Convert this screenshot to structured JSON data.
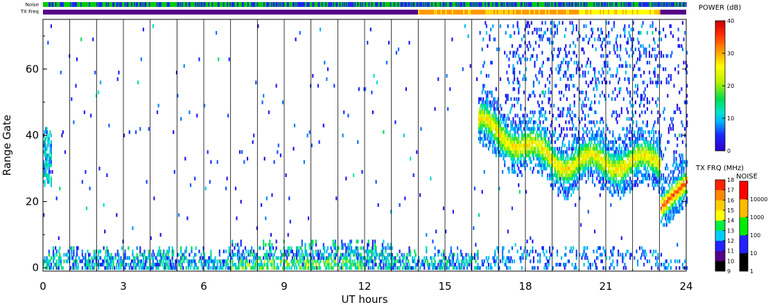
{
  "chart_data": {
    "type": "heatmap",
    "title": "",
    "xlabel": "UT hours",
    "ylabel": "Range Gate",
    "xlim": [
      0,
      24
    ],
    "ylim": [
      -1,
      75
    ],
    "x_ticks": [
      0,
      3,
      6,
      9,
      12,
      15,
      18,
      21,
      24
    ],
    "y_ticks": [
      0,
      20,
      40,
      60
    ],
    "hour_gridlines": [
      1,
      2,
      3,
      4,
      5,
      6,
      7,
      8,
      9,
      10,
      11,
      12,
      13,
      14,
      15,
      16,
      17,
      18,
      19,
      20,
      21,
      22,
      23
    ],
    "grid": true,
    "top_bars": {
      "noise_label": "Noise",
      "txfreq_label": "TX Freq",
      "noise_segments": [
        {
          "x0": 0,
          "x1": 24,
          "color": "#00cc00",
          "pattern": "mixed-blue"
        }
      ],
      "txfreq_segments": [
        {
          "x0": 0,
          "x1": 14.0,
          "color": "#550088"
        },
        {
          "x0": 14.0,
          "x1": 20.0,
          "color": "#ff9900"
        },
        {
          "x0": 20.0,
          "x1": 23.0,
          "color": "#ffff00"
        },
        {
          "x0": 23.0,
          "x1": 24,
          "color": "#550088"
        }
      ]
    },
    "power_colorbar": {
      "title": "POWER (dB)",
      "ticks": [
        "0",
        "10",
        "20",
        "30",
        "40"
      ],
      "range": [
        0,
        40
      ]
    },
    "txfreq_colorbar": {
      "title": "TX FRQ (MHz)",
      "ticks": [
        "9",
        "10",
        "11",
        "12",
        "13",
        "14",
        "15",
        "16",
        "17",
        "18"
      ],
      "colors": [
        "#000000",
        "#550088",
        "#2222ff",
        "#00ccff",
        "#00ee44",
        "#ffff00",
        "#ffcc00",
        "#ff8800",
        "#ff2200"
      ]
    },
    "noise_colorbar": {
      "title": "NOISE",
      "ticks": [
        "1",
        "10",
        "100",
        "1000",
        "10000"
      ],
      "colors": [
        "#000000",
        "#2222ff",
        "#00ee00",
        "#ffbb00",
        "#ff0000"
      ]
    },
    "features": [
      {
        "name": "near-range echoes",
        "x_range": [
          0,
          16
        ],
        "gate_range": [
          0,
          8
        ],
        "power_db": [
          5,
          20
        ]
      },
      {
        "name": "ionospheric scatter band",
        "x_range": [
          16,
          23
        ],
        "gate_range": [
          25,
          45
        ],
        "power_db": [
          10,
          30
        ]
      },
      {
        "name": "late band",
        "x_range": [
          23,
          24
        ],
        "gate_range": [
          15,
          30
        ],
        "power_db": [
          10,
          35
        ]
      }
    ]
  }
}
